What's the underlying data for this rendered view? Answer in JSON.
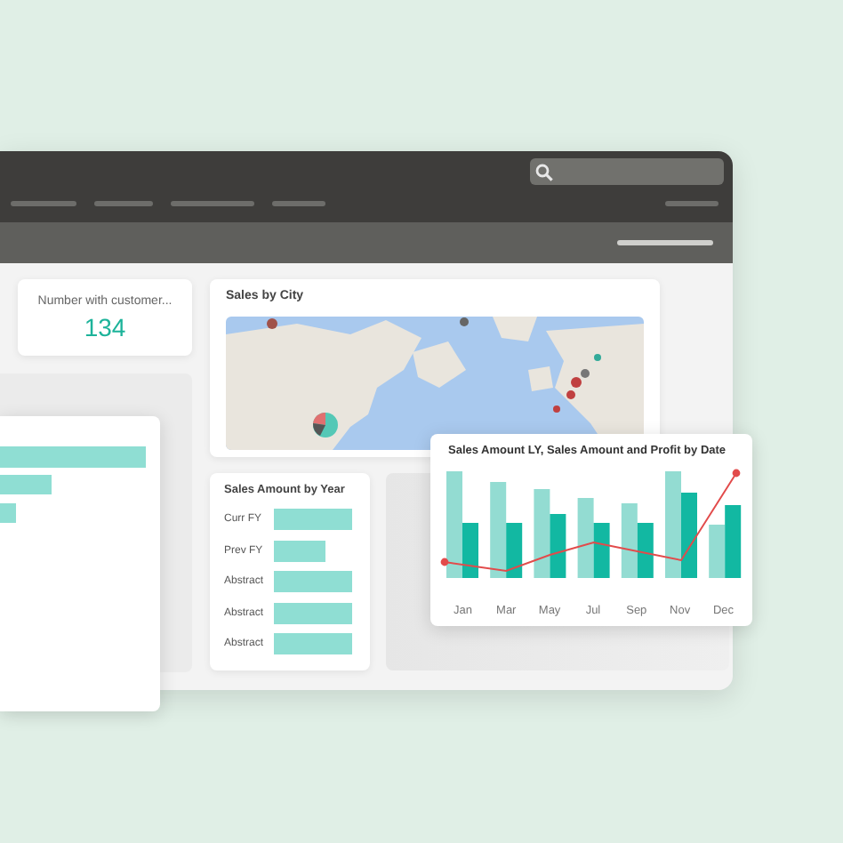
{
  "kpi_card": {
    "label": "Number with customer...",
    "value": "134"
  },
  "map_card": {
    "title": "Sales by City"
  },
  "year_card": {
    "title": "Sales Amount by Year",
    "rows": [
      {
        "label": "Curr FY"
      },
      {
        "label": "Prev FY"
      },
      {
        "label": "Abstract"
      },
      {
        "label": "Abstract"
      },
      {
        "label": "Abstract"
      }
    ]
  },
  "chart_card": {
    "title": "Sales Amount LY, Sales Amount and Profit by Date",
    "x_labels": [
      "Jan",
      "Mar",
      "May",
      "Jul",
      "Sep",
      "Nov",
      "Dec"
    ]
  }
}
